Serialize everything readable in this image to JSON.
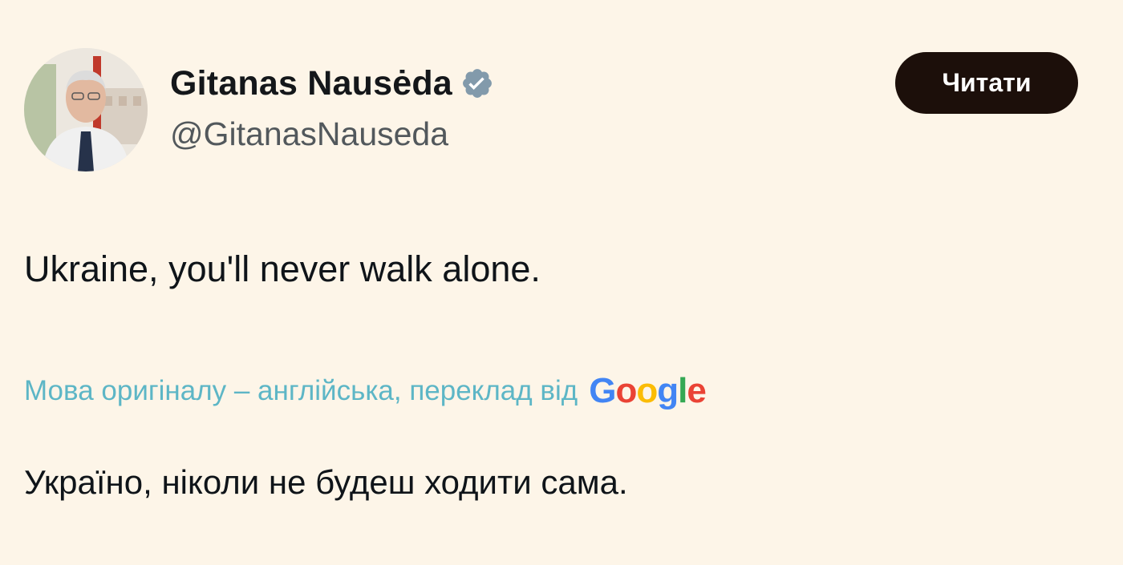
{
  "author": {
    "display_name": "Gitanas Nausėda",
    "handle": "@GitanasNauseda",
    "verified_icon": "verified-badge-icon",
    "verified_color": "#829aab"
  },
  "follow_button": {
    "label": "Читати",
    "bg_color": "#1c0f0a"
  },
  "tweet": {
    "text": "Ukraine, you'll never walk alone.",
    "translation_note": "Мова оригіналу – англійська, переклад від",
    "translation_provider": "Google",
    "translated_text": "Україно, ніколи не будеш ходити сама."
  },
  "colors": {
    "background": "#fdf5e8",
    "link": "#5db6c6"
  }
}
